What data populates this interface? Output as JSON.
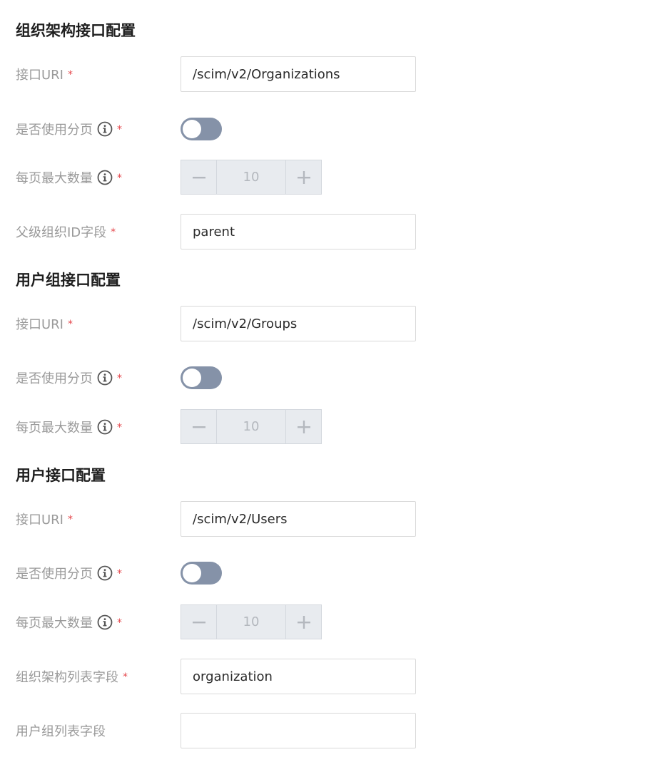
{
  "sections": [
    {
      "title": "组织架构接口配置",
      "uri_label": "接口URI",
      "uri_value": "/scim/v2/Organizations",
      "paging_label": "是否使用分页",
      "page_size_label": "每页最大数量",
      "page_size_value": "10",
      "parent_id_label": "父级组织ID字段",
      "parent_id_value": "parent"
    },
    {
      "title": "用户组接口配置",
      "uri_label": "接口URI",
      "uri_value": "/scim/v2/Groups",
      "paging_label": "是否使用分页",
      "page_size_label": "每页最大数量",
      "page_size_value": "10"
    },
    {
      "title": "用户接口配置",
      "uri_label": "接口URI",
      "uri_value": "/scim/v2/Users",
      "paging_label": "是否使用分页",
      "page_size_label": "每页最大数量",
      "page_size_value": "10",
      "org_list_label": "组织架构列表字段",
      "org_list_value": "organization",
      "group_list_label": "用户组列表字段",
      "group_list_value": ""
    }
  ],
  "required_mark": "*",
  "icons": {
    "info": "info-icon",
    "minus": "minus-icon",
    "plus": "plus-icon"
  },
  "colors": {
    "required": "#e5484d",
    "toggle_off": "#8592a8",
    "label": "#9a9a9a"
  }
}
